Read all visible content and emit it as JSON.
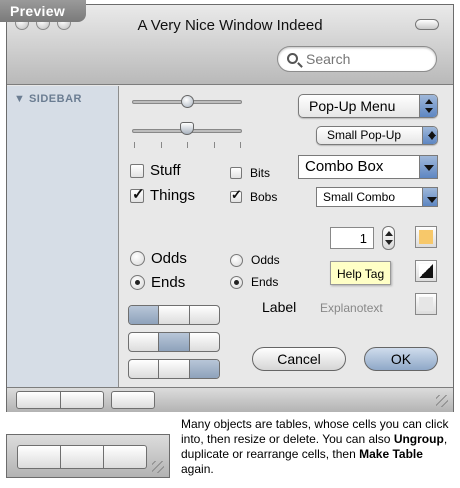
{
  "preview_tab": {
    "label": "Preview"
  },
  "window": {
    "title": "A Very Nice Window Indeed",
    "search": {
      "placeholder": "Search"
    },
    "sidebar": {
      "heading": "SIDEBAR"
    }
  },
  "controls": {
    "popup_menu": "Pop-Up Menu",
    "small_popup": "Small Pop-Up",
    "combo_box": "Combo Box",
    "small_combo": "Small Combo",
    "checkboxes": {
      "stuff": {
        "label": "Stuff",
        "checked": false
      },
      "things": {
        "label": "Things",
        "checked": true
      },
      "bits": {
        "label": "Bits",
        "checked": false
      },
      "bobs": {
        "label": "Bobs",
        "checked": true
      }
    },
    "radios_large": {
      "odds": "Odds",
      "ends": "Ends",
      "selected": "Ends"
    },
    "radios_small": {
      "odds": "Odds",
      "ends": "Ends",
      "selected": "Ends"
    },
    "stepper_value": "1",
    "help_tag": "Help Tag",
    "label": "Label",
    "explanotext": "Explanotext",
    "cancel_button": "Cancel",
    "ok_button": "OK",
    "sliders": {
      "top_value": 0.5,
      "bottom_value": 0.5
    },
    "color_wells": [
      "#f7c86a",
      "bw-diagonal",
      "#e6e6e6"
    ]
  },
  "caption": {
    "part1": "Many objects are tables, whose cells you can click into, then resize or delete. You can also ",
    "ungroup": "Ungroup",
    "part2": ", duplicate or rearrange cells, then ",
    "make_table": "Make Table",
    "part3": " again."
  }
}
